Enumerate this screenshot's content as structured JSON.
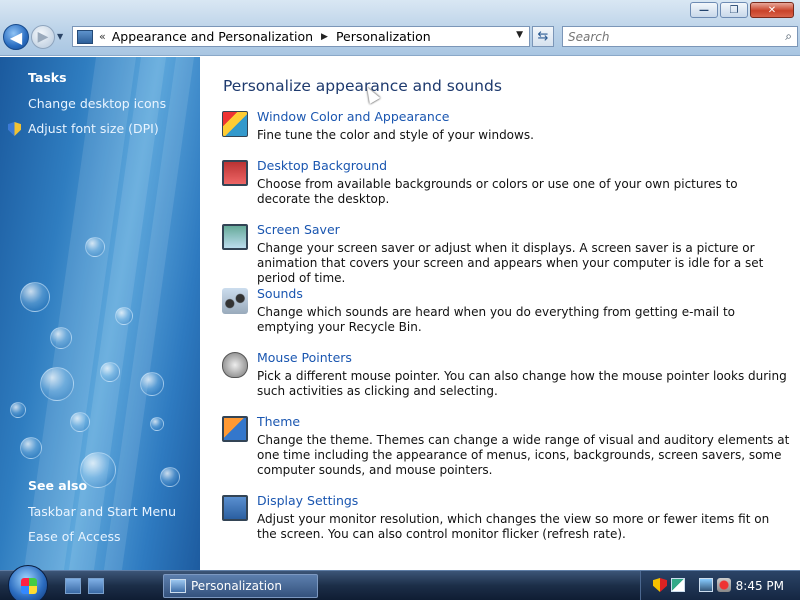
{
  "window": {
    "controls": {
      "minimize": "—",
      "maximize": "❐",
      "close": "✕"
    }
  },
  "nav": {
    "back_glyph": "◀",
    "forward_glyph": "▶",
    "dropdown_glyph": "▼"
  },
  "address": {
    "chevron": "«",
    "breadcrumbs": [
      "Appearance and Personalization",
      "Personalization"
    ],
    "separator": "▶",
    "dropdown_glyph": "▼",
    "refresh_glyph": "⇆"
  },
  "search": {
    "placeholder": "Search"
  },
  "sidebar": {
    "tasks_heading": "Tasks",
    "tasks": [
      "Change desktop icons",
      "Adjust font size (DPI)"
    ],
    "see_also_heading": "See also",
    "see_also": [
      "Taskbar and Start Menu",
      "Ease of Access"
    ]
  },
  "main": {
    "title": "Personalize appearance and sounds",
    "items": [
      {
        "title": "Window Color and Appearance",
        "desc": "Fine tune the color and style of your windows.",
        "icon": "window-color-icon"
      },
      {
        "title": "Desktop Background",
        "desc": "Choose from available backgrounds or colors or use one of your own pictures to decorate the desktop.",
        "icon": "desktop-background-icon"
      },
      {
        "title": "Screen Saver",
        "desc": "Change your screen saver or adjust when it displays. A screen saver is a picture or animation that covers your screen and appears when your computer is idle for a set period of time.",
        "icon": "screen-saver-icon"
      },
      {
        "title": "Sounds",
        "desc": "Change which sounds are heard when you do everything from getting e-mail to emptying your Recycle Bin.",
        "icon": "sounds-icon"
      },
      {
        "title": "Mouse Pointers",
        "desc": "Pick a different mouse pointer. You can also change how the mouse pointer looks during such activities as clicking and selecting.",
        "icon": "mouse-pointer-icon"
      },
      {
        "title": "Theme",
        "desc": "Change the theme. Themes can change a wide range of visual and auditory elements at one time including the appearance of menus, icons, backgrounds, screen savers, some computer sounds, and mouse pointers.",
        "icon": "theme-icon"
      },
      {
        "title": "Display Settings",
        "desc": "Adjust your monitor resolution, which changes the view so more or fewer items fit on the screen. You can also control monitor flicker (refresh rate).",
        "icon": "display-settings-icon"
      }
    ]
  },
  "taskbar": {
    "task_label": "Personalization",
    "clock": "8:45 PM"
  },
  "colors": {
    "link": "#1a56b0",
    "title": "#1e3a6e",
    "sidebar": "#2f7dc0"
  }
}
